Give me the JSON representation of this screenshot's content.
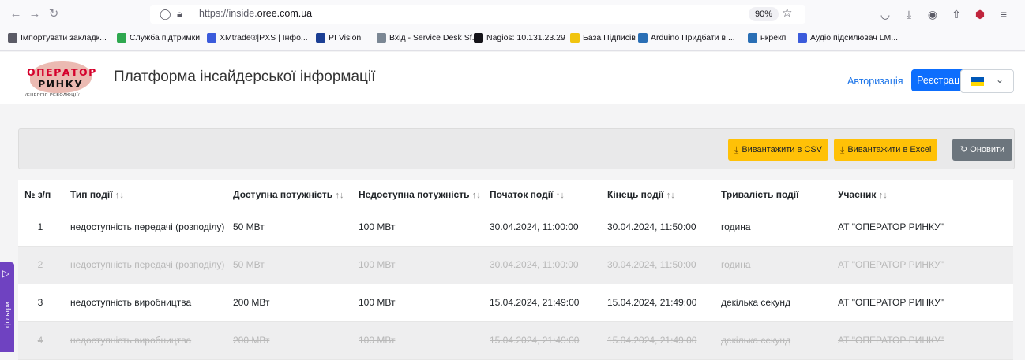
{
  "browser": {
    "url_prefix": "https://inside.",
    "url_domain": "oree.com.ua",
    "zoom": "90%",
    "bookmarks": [
      {
        "label": "Імпортувати закладк...",
        "icon": "import-icon",
        "color": "#5b5b66"
      },
      {
        "label": "Служба підтримки",
        "icon": "support-icon",
        "color": "#2fa84f"
      },
      {
        "label": "XMtrade®|PXS | Інфо...",
        "icon": "xmtrade-icon",
        "color": "#3b5bdb"
      },
      {
        "label": "PI Vision",
        "icon": "pivision-icon",
        "color": "#1c3f94"
      },
      {
        "label": "Вхід - Service Desk Sf...",
        "icon": "servicedesk-icon",
        "color": "#7b8794"
      },
      {
        "label": "Nagios: 10.131.23.29",
        "icon": "nagios-icon",
        "color": "#15141a"
      },
      {
        "label": "База Підписів",
        "icon": "signature-icon",
        "color": "#f1c40f"
      },
      {
        "label": "Arduino Придбати в ...",
        "icon": "arduino-icon",
        "color": "#2a6fb5"
      },
      {
        "label": "нкрекп",
        "icon": "nkrekp-icon",
        "color": "#2a6fb5"
      },
      {
        "label": "Аудіо підсилювач LM...",
        "icon": "audio-icon",
        "color": "#3b5bdb"
      }
    ]
  },
  "header": {
    "logo_line1": "ОПЕРАТОР",
    "logo_line2": "РИНКУ",
    "logo_line3": "/ЕНЕРГІЯ РЕВОЛЮЦІЇ/",
    "title": "Платформа інсайдерської інформації",
    "login": "Авторизація",
    "register": "Реєстрація",
    "language_flag": "ukraine-flag-icon"
  },
  "toolbar": {
    "csv": "Вивантажити в CSV",
    "excel": "Вивантажити в Excel",
    "refresh": "Оновити",
    "accent_yellow": "#ffc107",
    "accent_gray": "#6c757d"
  },
  "table": {
    "sort_glyph": "↑↓",
    "columns": [
      {
        "label": "№ з/п",
        "sortable": false
      },
      {
        "label": "Тип події",
        "sortable": true
      },
      {
        "label": "Доступна потужність",
        "sortable": true
      },
      {
        "label": "Недоступна потужність",
        "sortable": true
      },
      {
        "label": "Початок події",
        "sortable": true
      },
      {
        "label": "Кінець події",
        "sortable": true
      },
      {
        "label": "Тривалість події",
        "sortable": false
      },
      {
        "label": "Учасник",
        "sortable": true
      }
    ],
    "rows": [
      {
        "active": true,
        "cells": [
          "1",
          "недоступність передачі (розподілу)",
          "50 МВт",
          "100 МВт",
          "30.04.2024, 11:00:00",
          "30.04.2024, 11:50:00",
          "година",
          "АТ \"ОПЕРАТОР РИНКУ\""
        ]
      },
      {
        "active": false,
        "cells": [
          "2",
          "недоступність передачі (розподілу)",
          "50 МВт",
          "100 МВт",
          "30.04.2024, 11:00:00",
          "30.04.2024, 11:50:00",
          "година",
          "АТ \"ОПЕРАТОР РИНКУ\""
        ]
      },
      {
        "active": true,
        "cells": [
          "3",
          "недоступність виробництва",
          "200 МВт",
          "100 МВт",
          "15.04.2024, 21:49:00",
          "15.04.2024, 21:49:00",
          "декілька секунд",
          "АТ \"ОПЕРАТОР РИНКУ\""
        ]
      },
      {
        "active": false,
        "cells": [
          "4",
          "недоступність виробництва",
          "200 МВт",
          "100 МВт",
          "15.04.2024, 21:49:00",
          "15.04.2024, 21:49:00",
          "декілька секунд",
          "АТ \"ОПЕРАТОР РИНКУ\""
        ]
      }
    ]
  },
  "filters": {
    "label": "фільтри",
    "color": "#6f42c1"
  }
}
